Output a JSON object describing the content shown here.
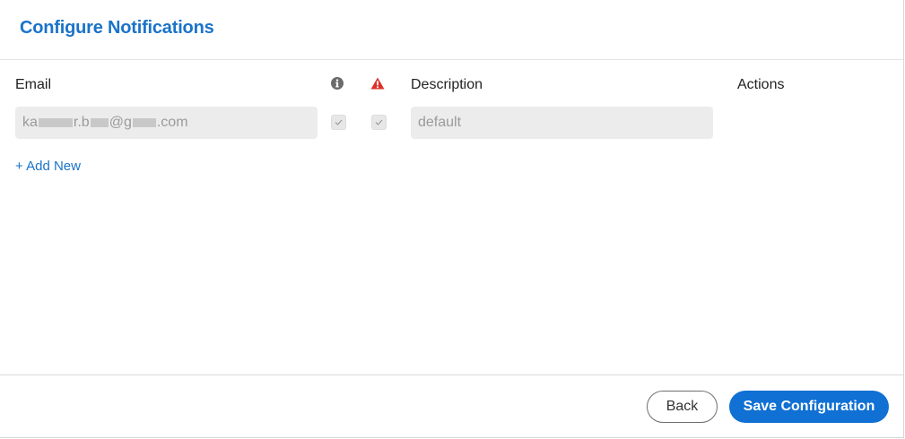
{
  "header": {
    "title": "Configure Notifications"
  },
  "table": {
    "columns": {
      "email": "Email",
      "info_icon": "info-icon",
      "warning_icon": "warning-icon",
      "description": "Description",
      "actions": "Actions"
    },
    "rows": [
      {
        "email_parts": [
          "ka",
          "r.b",
          "@g",
          ".com"
        ],
        "info_checked": true,
        "warning_checked": true,
        "description": "default"
      }
    ],
    "add_new_label": "+ Add New"
  },
  "footer": {
    "back_label": "Back",
    "save_label": "Save Configuration"
  },
  "colors": {
    "accent": "#1a73c9",
    "primary_button": "#1070d3",
    "warning": "#d9322b",
    "info": "#6b6b6b",
    "field_bg": "#ececec"
  }
}
